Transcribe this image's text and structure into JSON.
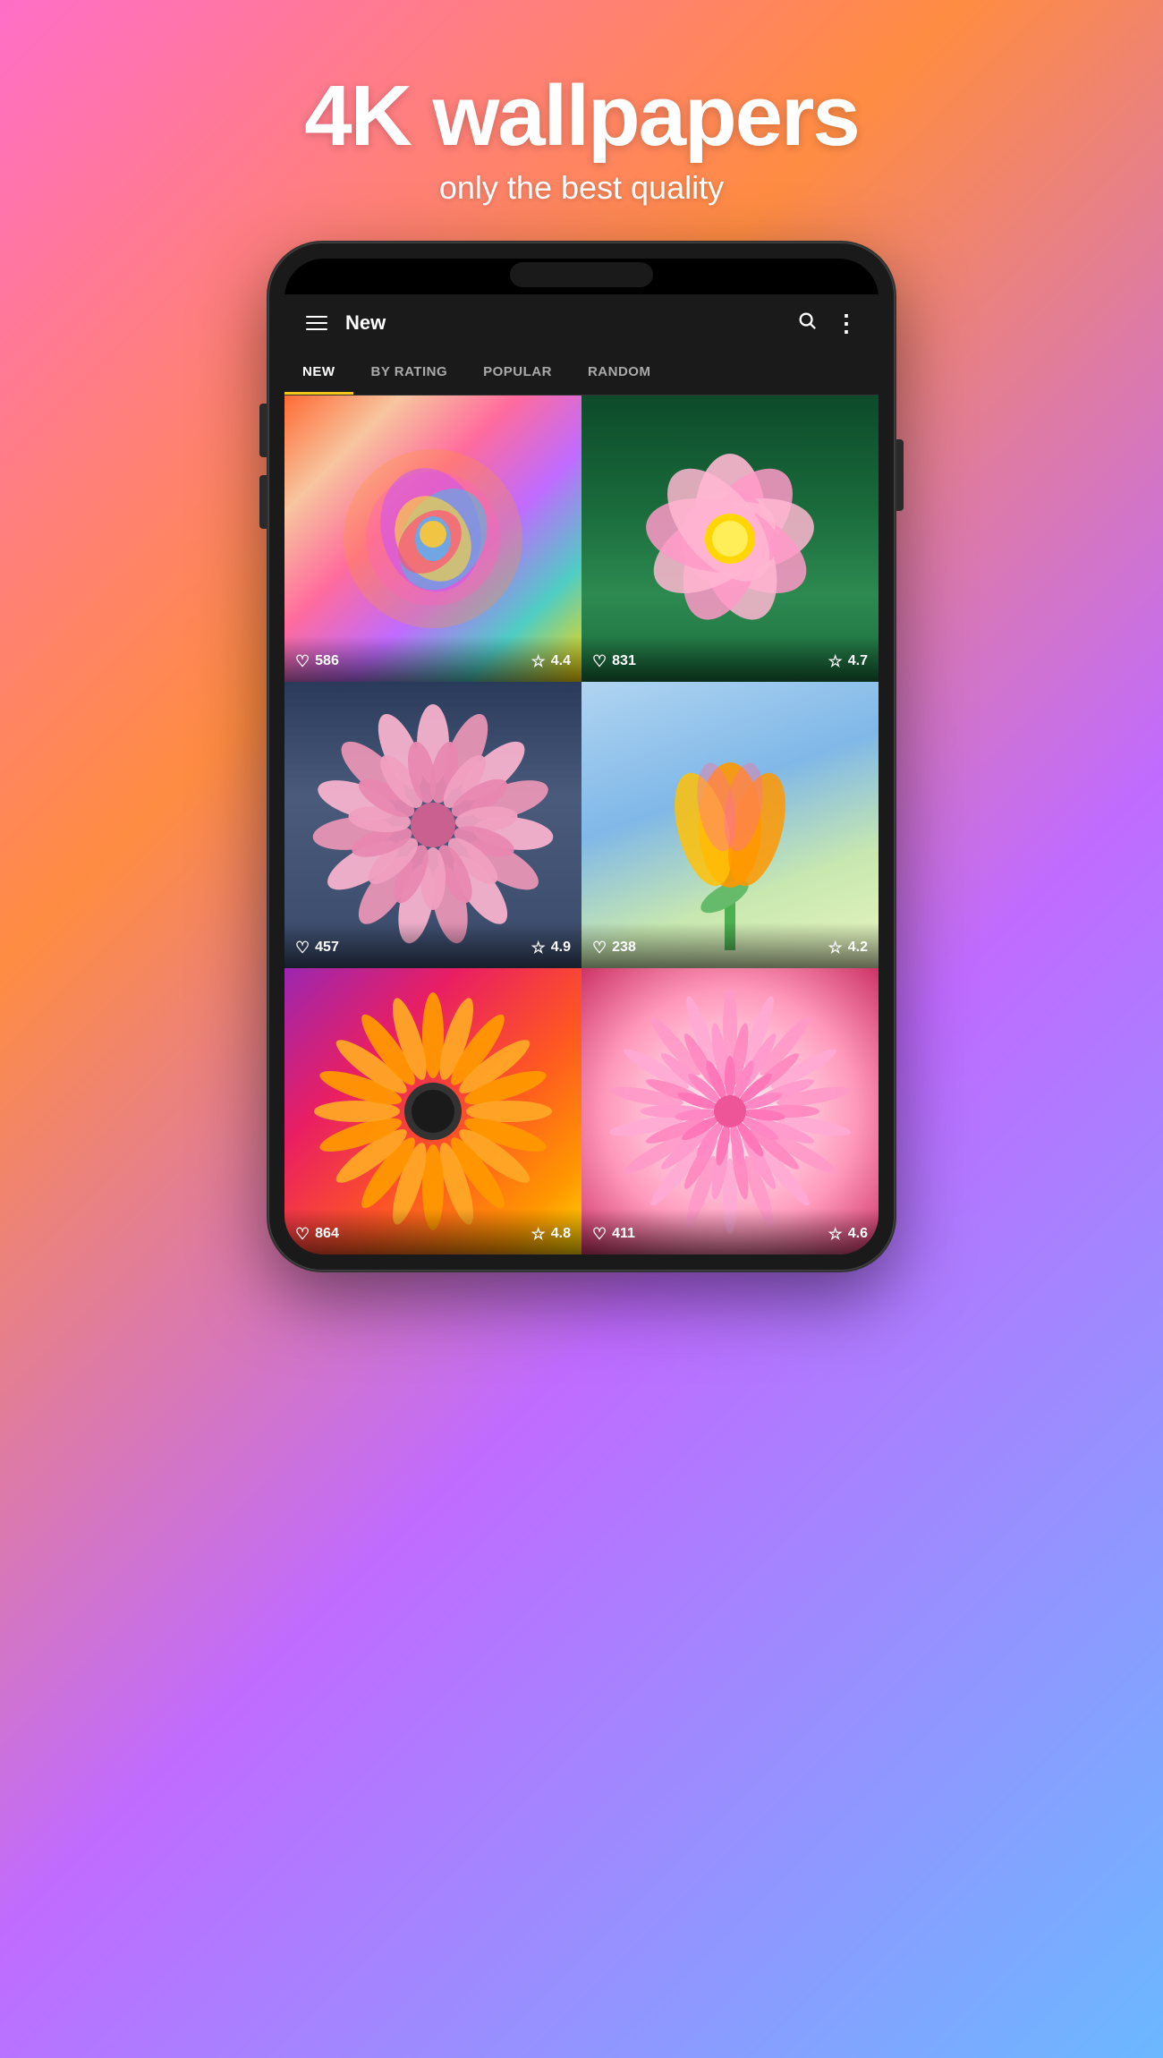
{
  "hero": {
    "title": "4K wallpapers",
    "subtitle": "only the best quality"
  },
  "app": {
    "title": "New",
    "tabs": [
      {
        "id": "new",
        "label": "NEW",
        "active": true
      },
      {
        "id": "by-rating",
        "label": "BY RATING",
        "active": false
      },
      {
        "id": "popular",
        "label": "POPULAR",
        "active": false
      },
      {
        "id": "random",
        "label": "RANDOM",
        "active": false
      }
    ]
  },
  "wallpapers": [
    {
      "id": 1,
      "likes": "586",
      "rating": "4.4",
      "colorClass": "flower-1"
    },
    {
      "id": 2,
      "likes": "831",
      "rating": "4.7",
      "colorClass": "flower-2"
    },
    {
      "id": 3,
      "likes": "457",
      "rating": "4.9",
      "colorClass": "flower-3"
    },
    {
      "id": 4,
      "likes": "238",
      "rating": "4.2",
      "colorClass": "flower-4"
    },
    {
      "id": 5,
      "likes": "864",
      "rating": "4.8",
      "colorClass": "flower-5"
    },
    {
      "id": 6,
      "likes": "411",
      "rating": "4.6",
      "colorClass": "flower-6"
    }
  ],
  "icons": {
    "hamburger": "☰",
    "search": "🔍",
    "more": "⋮",
    "heart": "♡",
    "star": "☆"
  }
}
